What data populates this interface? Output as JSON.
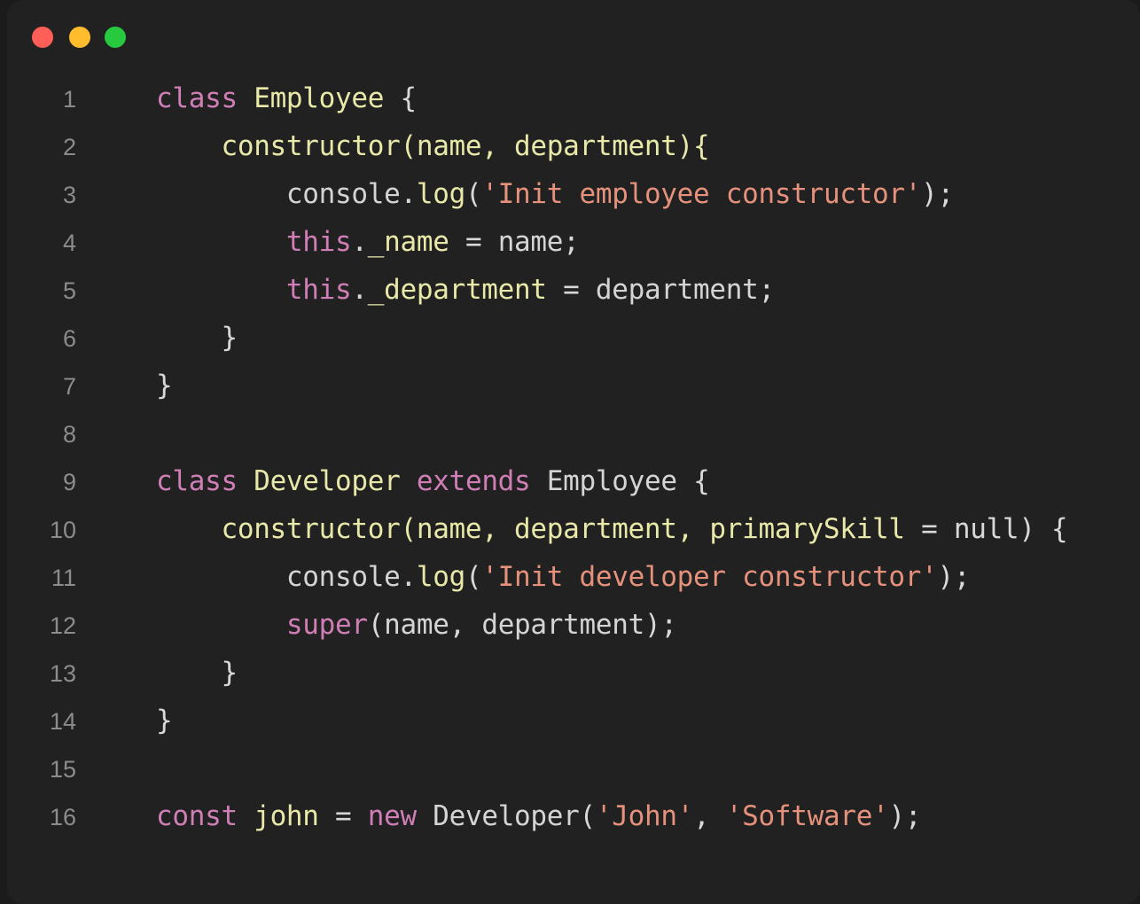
{
  "window": {
    "title": "",
    "controls": [
      {
        "name": "close",
        "color": "#ff5f56",
        "label": "Close"
      },
      {
        "name": "minimize",
        "color": "#ffbd2e",
        "label": "Minimize"
      },
      {
        "name": "maximize",
        "color": "#27c93f",
        "label": "Maximize"
      }
    ],
    "background": "#212121"
  },
  "editor": {
    "language": "javascript",
    "theme": {
      "background": "#212121",
      "gutter_text": "#8c8c8c",
      "plain": "#d8d8d8",
      "keyword": "#cf7fb6",
      "entity": "#e8e8a8",
      "variable": "#86c8ea",
      "string": "#e5917c"
    },
    "line_numbers": [
      "1",
      "2",
      "3",
      "4",
      "5",
      "6",
      "7",
      "8",
      "9",
      "10",
      "11",
      "12",
      "13",
      "14",
      "15",
      "16"
    ],
    "lines": [
      {
        "number": "1",
        "tokens": [
          {
            "t": "class",
            "c": "keyword"
          },
          {
            "t": " ",
            "c": "plain"
          },
          {
            "t": "Employee",
            "c": "entity"
          },
          {
            "t": " ",
            "c": "plain"
          },
          {
            "t": "{",
            "c": "punct"
          }
        ]
      },
      {
        "number": "2",
        "tokens": [
          {
            "t": "    ",
            "c": "plain"
          },
          {
            "t": "constructor(name, department){",
            "c": "entity"
          }
        ]
      },
      {
        "number": "3",
        "tokens": [
          {
            "t": "        ",
            "c": "plain"
          },
          {
            "t": "console",
            "c": "variable"
          },
          {
            "t": ".",
            "c": "punct"
          },
          {
            "t": "log",
            "c": "entity"
          },
          {
            "t": "(",
            "c": "punct"
          },
          {
            "t": "'Init employee constructor'",
            "c": "string"
          },
          {
            "t": ");",
            "c": "punct"
          }
        ]
      },
      {
        "number": "4",
        "tokens": [
          {
            "t": "        ",
            "c": "plain"
          },
          {
            "t": "this",
            "c": "keyword"
          },
          {
            "t": ".",
            "c": "punct"
          },
          {
            "t": "_name",
            "c": "entity"
          },
          {
            "t": " = ",
            "c": "punct"
          },
          {
            "t": "name",
            "c": "variable"
          },
          {
            "t": ";",
            "c": "punct"
          }
        ]
      },
      {
        "number": "5",
        "tokens": [
          {
            "t": "        ",
            "c": "plain"
          },
          {
            "t": "this",
            "c": "keyword"
          },
          {
            "t": ".",
            "c": "punct"
          },
          {
            "t": "_department",
            "c": "entity"
          },
          {
            "t": " = ",
            "c": "punct"
          },
          {
            "t": "department",
            "c": "variable"
          },
          {
            "t": ";",
            "c": "punct"
          }
        ]
      },
      {
        "number": "6",
        "tokens": [
          {
            "t": "    ",
            "c": "plain"
          },
          {
            "t": "}",
            "c": "punct"
          }
        ]
      },
      {
        "number": "7",
        "tokens": [
          {
            "t": "}",
            "c": "punct"
          }
        ]
      },
      {
        "number": "8",
        "tokens": []
      },
      {
        "number": "9",
        "tokens": [
          {
            "t": "class",
            "c": "keyword"
          },
          {
            "t": " ",
            "c": "plain"
          },
          {
            "t": "Developer",
            "c": "entity"
          },
          {
            "t": " ",
            "c": "plain"
          },
          {
            "t": "extends",
            "c": "keyword"
          },
          {
            "t": " ",
            "c": "plain"
          },
          {
            "t": "Employee",
            "c": "variable"
          },
          {
            "t": " ",
            "c": "plain"
          },
          {
            "t": "{",
            "c": "punct"
          }
        ]
      },
      {
        "number": "10",
        "tokens": [
          {
            "t": "    ",
            "c": "plain"
          },
          {
            "t": "constructor(name, department, primarySkill",
            "c": "entity"
          },
          {
            "t": " = ",
            "c": "punct"
          },
          {
            "t": "null",
            "c": "plain"
          },
          {
            "t": ") {",
            "c": "punct"
          }
        ]
      },
      {
        "number": "11",
        "tokens": [
          {
            "t": "        ",
            "c": "plain"
          },
          {
            "t": "console",
            "c": "variable"
          },
          {
            "t": ".",
            "c": "punct"
          },
          {
            "t": "log",
            "c": "entity"
          },
          {
            "t": "(",
            "c": "punct"
          },
          {
            "t": "'Init developer constructor'",
            "c": "string"
          },
          {
            "t": ");",
            "c": "punct"
          }
        ]
      },
      {
        "number": "12",
        "tokens": [
          {
            "t": "        ",
            "c": "plain"
          },
          {
            "t": "super",
            "c": "keyword"
          },
          {
            "t": "(",
            "c": "punct"
          },
          {
            "t": "name",
            "c": "variable"
          },
          {
            "t": ", ",
            "c": "punct"
          },
          {
            "t": "department",
            "c": "variable"
          },
          {
            "t": ");",
            "c": "punct"
          }
        ]
      },
      {
        "number": "13",
        "tokens": [
          {
            "t": "    ",
            "c": "plain"
          },
          {
            "t": "}",
            "c": "punct"
          }
        ]
      },
      {
        "number": "14",
        "tokens": [
          {
            "t": "}",
            "c": "punct"
          }
        ]
      },
      {
        "number": "15",
        "tokens": []
      },
      {
        "number": "16",
        "tokens": [
          {
            "t": "const",
            "c": "keyword"
          },
          {
            "t": " ",
            "c": "plain"
          },
          {
            "t": "john",
            "c": "entity"
          },
          {
            "t": " = ",
            "c": "punct"
          },
          {
            "t": "new",
            "c": "keyword"
          },
          {
            "t": " ",
            "c": "plain"
          },
          {
            "t": "Developer",
            "c": "variable"
          },
          {
            "t": "(",
            "c": "punct"
          },
          {
            "t": "'John'",
            "c": "string"
          },
          {
            "t": ", ",
            "c": "punct"
          },
          {
            "t": "'Software'",
            "c": "string"
          },
          {
            "t": ");",
            "c": "punct"
          }
        ]
      }
    ]
  }
}
